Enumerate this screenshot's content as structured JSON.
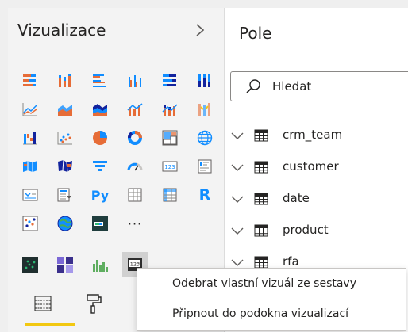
{
  "visualizations": {
    "title": "Vizualizace",
    "toggle_icon": "chevron-right-icon",
    "icons": [
      [
        "stacked-bar-icon",
        "stacked-column-icon",
        "clustered-bar-icon",
        "clustered-column-icon",
        "100-stacked-bar-icon",
        "100-stacked-column-icon"
      ],
      [
        "line-chart-icon",
        "area-chart-icon",
        "stacked-area-icon",
        "line-clustered-column-icon",
        "line-stacked-column-icon",
        "ribbon-chart-icon"
      ],
      [
        "waterfall-icon",
        "scatter-icon",
        "pie-chart-icon",
        "donut-chart-icon",
        "treemap-icon",
        "map-icon"
      ],
      [
        "filled-map-icon",
        "shape-map-icon",
        "funnel-icon",
        "gauge-icon",
        "card-icon",
        "multi-row-card-icon"
      ],
      [
        "kpi-icon",
        "slicer-icon",
        "python-visual-icon",
        "table-icon",
        "matrix-icon",
        "r-visual-icon"
      ],
      [
        "key-influencers-icon",
        "arcgis-map-icon",
        "custom-visual-icon",
        "more-visuals-icon"
      ]
    ],
    "py_label": "Py",
    "r_label": "R",
    "more_label": "···",
    "custom_visuals": [
      "custom-scatter-icon",
      "custom-heatmap-icon",
      "custom-bar-icon",
      "custom-card-icon"
    ],
    "custom_card_label": "123",
    "tabs": [
      "fields-tab-icon",
      "format-tab-icon"
    ]
  },
  "fields": {
    "title": "Pole",
    "search_placeholder": "Hledat",
    "tables": [
      "crm_team",
      "customer",
      "date",
      "product",
      "rfa"
    ]
  },
  "context_menu": {
    "items": [
      "Odebrat vlastní vizuál ze sestavy",
      "Připnout do podokna vizualizací"
    ]
  },
  "colors": {
    "accent_yellow": "#f2c811",
    "visual_blue": "#118dff",
    "visual_orange": "#e66c37",
    "visual_navy": "#12239e"
  }
}
